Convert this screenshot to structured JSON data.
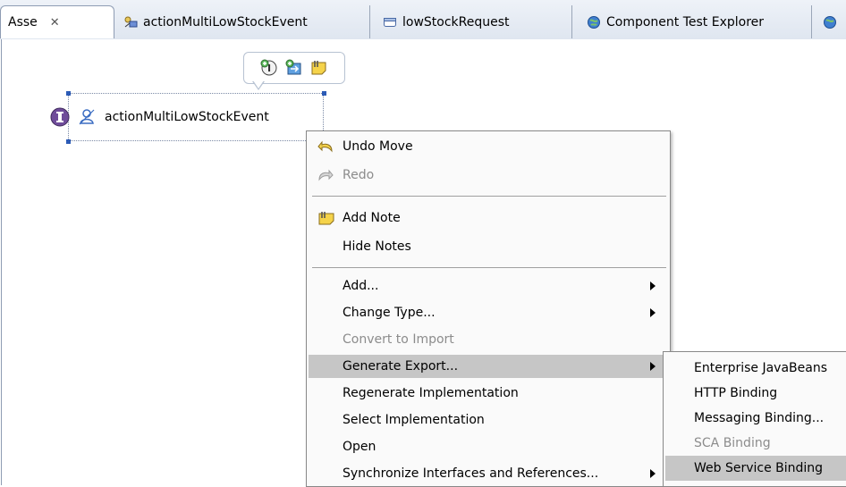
{
  "tabs": [
    {
      "label": "Asse",
      "icon": "close-icon",
      "close_glyph": "✕"
    },
    {
      "label": "actionMultiLowStockEvent",
      "icon": "process-icon"
    },
    {
      "label": "lowStockRequest",
      "icon": "window-icon"
    },
    {
      "label": "Component Test Explorer",
      "icon": "globe-icon"
    }
  ],
  "palette": {
    "icons": [
      "add-interface-icon",
      "add-reference-icon",
      "add-note-icon"
    ]
  },
  "node": {
    "label": "actionMultiLowStockEvent",
    "icons": [
      "interface-icon",
      "component-icon"
    ]
  },
  "context_menu": {
    "items": [
      {
        "label": "Undo Move",
        "icon": "undo-icon",
        "disabled": false
      },
      {
        "label": "Redo",
        "icon": "redo-icon",
        "disabled": true
      },
      {
        "label": "Add Note",
        "icon": "note-icon",
        "disabled": false
      },
      {
        "label": "Hide Notes",
        "disabled": false
      },
      {
        "label": "Add...",
        "disabled": false,
        "submenu": true
      },
      {
        "label": "Change Type...",
        "disabled": false,
        "submenu": true
      },
      {
        "label": "Convert to Import",
        "disabled": true
      },
      {
        "label": "Generate Export...",
        "disabled": false,
        "submenu": true,
        "highlighted": true
      },
      {
        "label": "Regenerate Implementation",
        "disabled": false
      },
      {
        "label": "Select Implementation",
        "disabled": false
      },
      {
        "label": "Open",
        "disabled": false
      },
      {
        "label": "Synchronize Interfaces and References...",
        "disabled": false,
        "submenu": true
      }
    ]
  },
  "submenu": {
    "items": [
      {
        "label": "Enterprise JavaBeans",
        "disabled": false
      },
      {
        "label": "HTTP Binding",
        "disabled": false
      },
      {
        "label": "Messaging Binding...",
        "disabled": false
      },
      {
        "label": "SCA Binding",
        "disabled": true
      },
      {
        "label": "Web Service Binding",
        "disabled": false,
        "highlighted": true
      }
    ]
  },
  "colors": {
    "highlight": "#c6c6c6",
    "disabled_text": "#8c8c8c",
    "tab_border": "#8e9cb3"
  }
}
